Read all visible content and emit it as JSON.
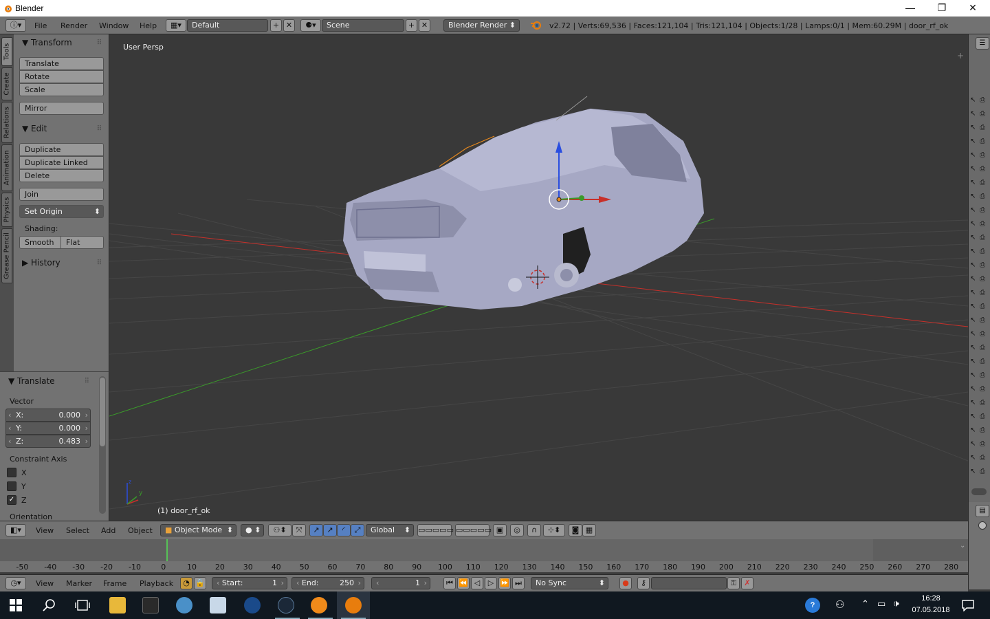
{
  "window": {
    "title": "Blender",
    "minimize": "—",
    "maximize": "❐",
    "close": "✕"
  },
  "infobar": {
    "menus": [
      "File",
      "Render",
      "Window",
      "Help"
    ],
    "screen_layout": "Default",
    "scene": "Scene",
    "render_engine": "Blender Render",
    "stats": "v2.72 | Verts:69,536 | Faces:121,104 | Tris:121,104 | Objects:1/28 | Lamps:0/1 | Mem:60.29M | door_rf_ok"
  },
  "tool_tabs": [
    "Tools",
    "Create",
    "Relations",
    "Animation",
    "Physics",
    "Grease Pencil"
  ],
  "tool_panel": {
    "transform_header": "Transform",
    "translate": "Translate",
    "rotate": "Rotate",
    "scale": "Scale",
    "mirror": "Mirror",
    "edit_header": "Edit",
    "duplicate": "Duplicate",
    "duplicate_linked": "Duplicate Linked",
    "delete": "Delete",
    "join": "Join",
    "set_origin": "Set Origin",
    "shading_label": "Shading:",
    "smooth": "Smooth",
    "flat": "Flat",
    "history_header": "History"
  },
  "operator_panel": {
    "header": "Translate",
    "vector_label": "Vector",
    "x_label": "X:",
    "x_value": "0.000",
    "y_label": "Y:",
    "y_value": "0.000",
    "z_label": "Z:",
    "z_value": "0.483",
    "constraint_label": "Constraint Axis",
    "cx": "X",
    "cy": "Y",
    "cz": "Z",
    "cz_checked": true,
    "orientation_label": "Orientation"
  },
  "viewport": {
    "view_label": "User Persp",
    "object_label": "(1) door_rf_ok",
    "axis_y": "y",
    "axis_z": "z"
  },
  "viewport_header": {
    "menus": [
      "View",
      "Select",
      "Add",
      "Object"
    ],
    "mode": "Object Mode",
    "orientation": "Global"
  },
  "timeline": {
    "ticks": [
      "-50",
      "-40",
      "-30",
      "-20",
      "-10",
      "0",
      "10",
      "20",
      "30",
      "40",
      "50",
      "60",
      "70",
      "80",
      "90",
      "100",
      "110",
      "120",
      "130",
      "140",
      "150",
      "160",
      "170",
      "180",
      "190",
      "200",
      "210",
      "220",
      "230",
      "240",
      "250",
      "260",
      "270",
      "280"
    ],
    "current_frame_marker": 0,
    "menus": [
      "View",
      "Marker",
      "Frame",
      "Playback"
    ],
    "start_label": "Start:",
    "start_value": "1",
    "end_label": "End:",
    "end_value": "250",
    "current_frame": "1",
    "sync": "No Sync"
  },
  "taskbar": {
    "time": "16:28",
    "date": "07.05.2018"
  },
  "colors": {
    "axis_x": "#c8302a",
    "axis_y": "#3a9a2a",
    "axis_z": "#2a4ee0",
    "car_body": "#a6a8c4"
  }
}
